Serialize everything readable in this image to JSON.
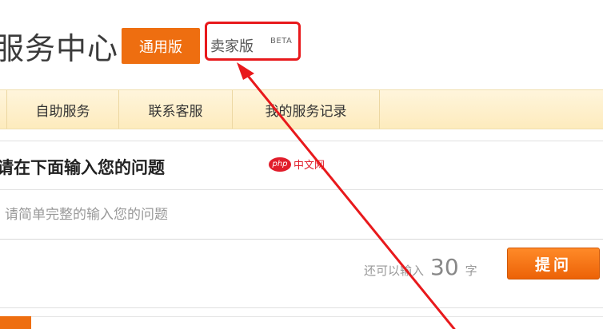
{
  "header": {
    "title": "服务中心",
    "edition_general": "通用版",
    "edition_seller": "卖家版",
    "beta_badge": "BETA"
  },
  "nav": {
    "items": [
      {
        "label": "自助服务"
      },
      {
        "label": "联系客服"
      },
      {
        "label": "我的服务记录"
      }
    ]
  },
  "question": {
    "heading": "请在下面输入您的问题",
    "placeholder": "请简单完整的输入您的问题",
    "counter_prefix": "还可以输入",
    "counter_value": "30",
    "counter_unit": "字",
    "submit_label": "提问"
  },
  "watermark": {
    "logo": "php",
    "text": "中文网"
  },
  "annotation": {
    "highlight_color": "#e8191c",
    "accent_color": "#ee6e10"
  }
}
